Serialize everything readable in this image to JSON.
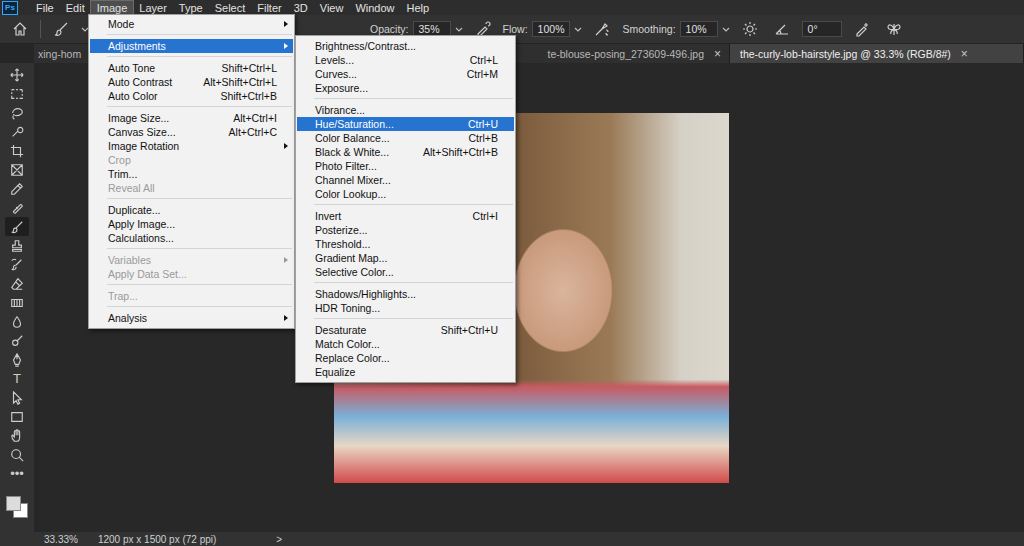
{
  "menubar": {
    "logo": "Ps",
    "items": [
      {
        "label": "File",
        "selected": false
      },
      {
        "label": "Edit",
        "selected": false
      },
      {
        "label": "Image",
        "selected": true
      },
      {
        "label": "Layer",
        "selected": false
      },
      {
        "label": "Type",
        "selected": false
      },
      {
        "label": "Select",
        "selected": false
      },
      {
        "label": "Filter",
        "selected": false
      },
      {
        "label": "3D",
        "selected": false
      },
      {
        "label": "View",
        "selected": false
      },
      {
        "label": "Window",
        "selected": false
      },
      {
        "label": "Help",
        "selected": false
      }
    ]
  },
  "options_bar": {
    "fields": [
      {
        "label": "Opacity:",
        "value": "35%"
      },
      {
        "label": "Flow:",
        "value": "100%"
      },
      {
        "label": "Smoothing:",
        "value": "10%"
      }
    ],
    "angle": "0°"
  },
  "tabs": [
    {
      "label": "xing-hom",
      "selected": false
    },
    {
      "label": "te-blouse-posing_273609-496.jpg",
      "selected": false,
      "close": "×"
    },
    {
      "label": "the-curly-lob-hairstyle.jpg @ 33.3% (RGB/8#)",
      "selected": true,
      "close": "×"
    }
  ],
  "tools": [
    {
      "selected": false
    },
    {
      "selected": false
    },
    {
      "selected": false
    },
    {
      "selected": false
    },
    {
      "selected": false
    },
    {
      "selected": false
    },
    {
      "selected": false
    },
    {
      "selected": false
    },
    {
      "selected": true
    },
    {
      "selected": false
    },
    {
      "selected": false
    },
    {
      "selected": false
    },
    {
      "selected": false
    },
    {
      "selected": false
    },
    {
      "selected": false
    },
    {
      "selected": false
    },
    {
      "selected": false,
      "glyph": "T"
    },
    {
      "selected": false
    },
    {
      "selected": false
    },
    {
      "selected": false
    },
    {
      "selected": false
    },
    {
      "selected": false,
      "glyph": "•••"
    }
  ],
  "image_menu": {
    "items": [
      {
        "kind": "item",
        "label": "Mode",
        "submenu": true,
        "disabled": false,
        "selected": false
      },
      {
        "kind": "separator"
      },
      {
        "kind": "item",
        "label": "Adjustments",
        "submenu": true,
        "disabled": false,
        "selected": true
      },
      {
        "kind": "separator"
      },
      {
        "kind": "item",
        "label": "Auto Tone",
        "shortcut": "Shift+Ctrl+L",
        "submenu": false,
        "disabled": false,
        "selected": false
      },
      {
        "kind": "item",
        "label": "Auto Contrast",
        "shortcut": "Alt+Shift+Ctrl+L",
        "submenu": false,
        "disabled": false,
        "selected": false
      },
      {
        "kind": "item",
        "label": "Auto Color",
        "shortcut": "Shift+Ctrl+B",
        "submenu": false,
        "disabled": false,
        "selected": false
      },
      {
        "kind": "separator"
      },
      {
        "kind": "item",
        "label": "Image Size...",
        "shortcut": "Alt+Ctrl+I",
        "submenu": false,
        "disabled": false,
        "selected": false
      },
      {
        "kind": "item",
        "label": "Canvas Size...",
        "shortcut": "Alt+Ctrl+C",
        "submenu": false,
        "disabled": false,
        "selected": false
      },
      {
        "kind": "item",
        "label": "Image Rotation",
        "submenu": true,
        "disabled": false,
        "selected": false
      },
      {
        "kind": "item",
        "label": "Crop",
        "submenu": false,
        "disabled": true,
        "selected": false
      },
      {
        "kind": "item",
        "label": "Trim...",
        "submenu": false,
        "disabled": false,
        "selected": false
      },
      {
        "kind": "item",
        "label": "Reveal All",
        "submenu": false,
        "disabled": true,
        "selected": false
      },
      {
        "kind": "separator"
      },
      {
        "kind": "item",
        "label": "Duplicate...",
        "submenu": false,
        "disabled": false,
        "selected": false
      },
      {
        "kind": "item",
        "label": "Apply Image...",
        "submenu": false,
        "disabled": false,
        "selected": false
      },
      {
        "kind": "item",
        "label": "Calculations...",
        "submenu": false,
        "disabled": false,
        "selected": false
      },
      {
        "kind": "separator"
      },
      {
        "kind": "item",
        "label": "Variables",
        "submenu": true,
        "disabled": true,
        "selected": false
      },
      {
        "kind": "item",
        "label": "Apply Data Set...",
        "submenu": false,
        "disabled": true,
        "selected": false
      },
      {
        "kind": "separator"
      },
      {
        "kind": "item",
        "label": "Trap...",
        "submenu": false,
        "disabled": true,
        "selected": false
      },
      {
        "kind": "separator"
      },
      {
        "kind": "item",
        "label": "Analysis",
        "submenu": true,
        "disabled": false,
        "selected": false
      }
    ]
  },
  "adjustments_menu": {
    "items": [
      {
        "kind": "item",
        "label": "Brightness/Contrast...",
        "selected": false
      },
      {
        "kind": "item",
        "label": "Levels...",
        "shortcut": "Ctrl+L",
        "selected": false
      },
      {
        "kind": "item",
        "label": "Curves...",
        "shortcut": "Ctrl+M",
        "selected": false
      },
      {
        "kind": "item",
        "label": "Exposure...",
        "selected": false
      },
      {
        "kind": "separator"
      },
      {
        "kind": "item",
        "label": "Vibrance...",
        "selected": false
      },
      {
        "kind": "item",
        "label": "Hue/Saturation...",
        "shortcut": "Ctrl+U",
        "selected": true
      },
      {
        "kind": "item",
        "label": "Color Balance...",
        "shortcut": "Ctrl+B",
        "selected": false
      },
      {
        "kind": "item",
        "label": "Black & White...",
        "shortcut": "Alt+Shift+Ctrl+B",
        "selected": false
      },
      {
        "kind": "item",
        "label": "Photo Filter...",
        "selected": false
      },
      {
        "kind": "item",
        "label": "Channel Mixer...",
        "selected": false
      },
      {
        "kind": "item",
        "label": "Color Lookup...",
        "selected": false
      },
      {
        "kind": "separator"
      },
      {
        "kind": "item",
        "label": "Invert",
        "shortcut": "Ctrl+I",
        "selected": false
      },
      {
        "kind": "item",
        "label": "Posterize...",
        "selected": false
      },
      {
        "kind": "item",
        "label": "Threshold...",
        "selected": false
      },
      {
        "kind": "item",
        "label": "Gradient Map...",
        "selected": false
      },
      {
        "kind": "item",
        "label": "Selective Color...",
        "selected": false
      },
      {
        "kind": "separator"
      },
      {
        "kind": "item",
        "label": "Shadows/Highlights...",
        "selected": false
      },
      {
        "kind": "item",
        "label": "HDR Toning...",
        "selected": false
      },
      {
        "kind": "separator"
      },
      {
        "kind": "item",
        "label": "Desaturate",
        "shortcut": "Shift+Ctrl+U",
        "selected": false
      },
      {
        "kind": "item",
        "label": "Match Color...",
        "selected": false
      },
      {
        "kind": "item",
        "label": "Replace Color...",
        "selected": false
      },
      {
        "kind": "item",
        "label": "Equalize",
        "selected": false
      }
    ]
  },
  "status_bar": {
    "zoom": "33.33%",
    "doc_info": "1200 px x 1500 px (72 ppi)",
    "arrow": ">"
  }
}
